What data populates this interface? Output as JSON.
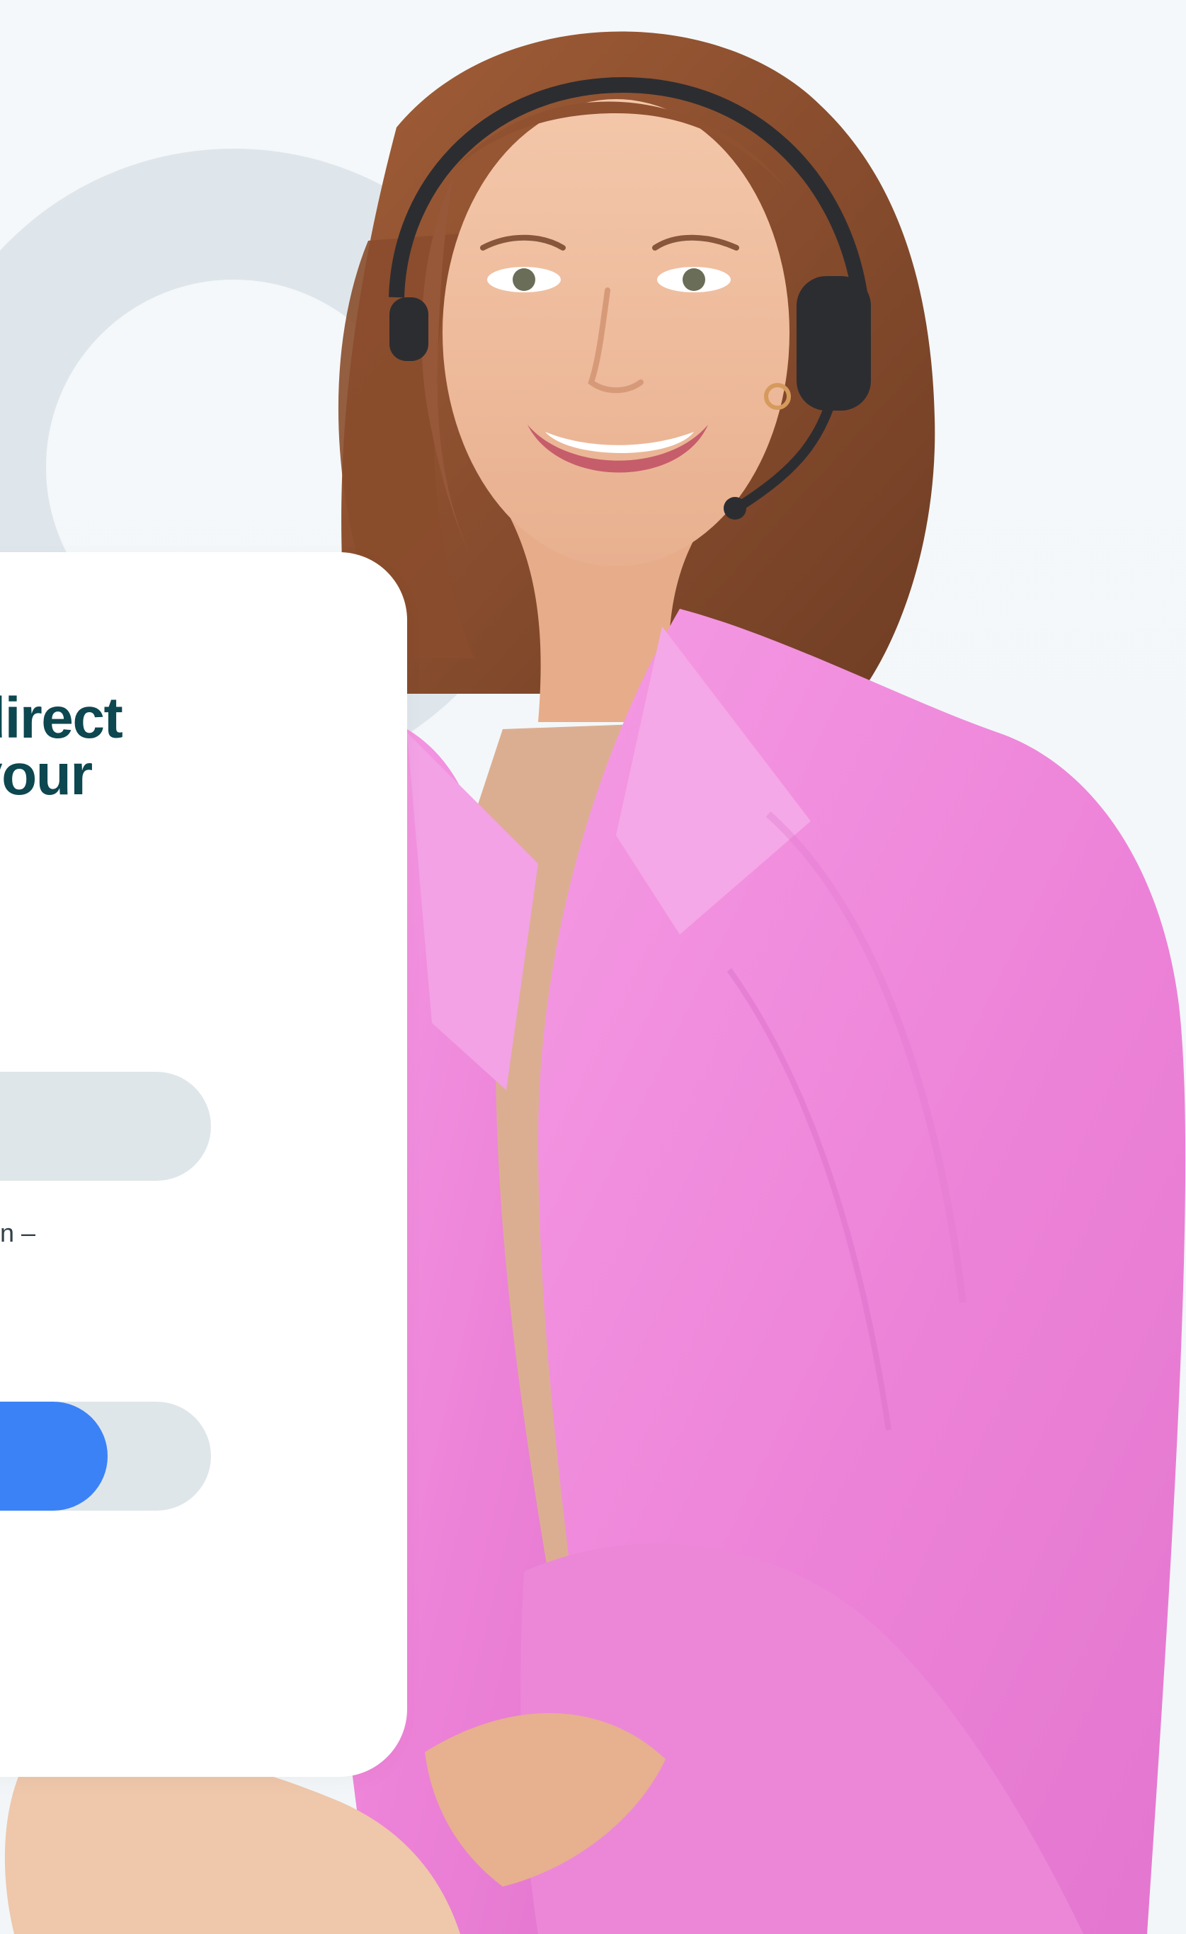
{
  "hero": {
    "headline": "direct\nyour",
    "helper_text": "n –",
    "input_value": "",
    "toggle_level": 0.65
  },
  "photo": {
    "subject": "smiling woman wearing headset and pink blazer"
  },
  "colors": {
    "page_background": "#f3f7f9",
    "ring": "#dde5ea",
    "card": "#ffffff",
    "headline": "#0d4750",
    "field": "#dfe6ea",
    "accent": "#3b82f6",
    "blazer": "#ef86dc",
    "shirt": "#dcae91",
    "hair": "#8a4d2c",
    "skin": "#f0c1a2",
    "headset": "#2c2d31"
  }
}
